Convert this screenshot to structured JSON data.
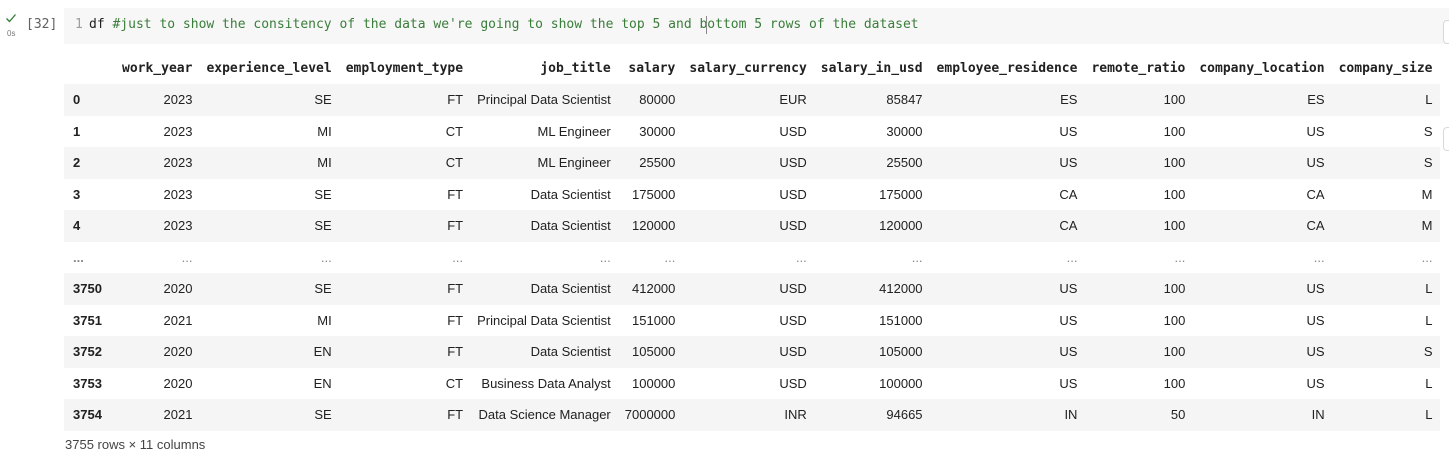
{
  "cell": {
    "execution_count": "[32]",
    "exec_time": "0s",
    "line_number": "1",
    "code_var": "df",
    "code_comment": "#just to show the consitency of the data we're going to show the top 5 and bottom 5 rows of the dataset"
  },
  "table": {
    "columns": [
      "work_year",
      "experience_level",
      "employment_type",
      "job_title",
      "salary",
      "salary_currency",
      "salary_in_usd",
      "employee_residence",
      "remote_ratio",
      "company_location",
      "company_size"
    ],
    "rows": [
      {
        "index": "0",
        "cells": [
          "2023",
          "SE",
          "FT",
          "Principal Data Scientist",
          "80000",
          "EUR",
          "85847",
          "ES",
          "100",
          "ES",
          "L"
        ]
      },
      {
        "index": "1",
        "cells": [
          "2023",
          "MI",
          "CT",
          "ML Engineer",
          "30000",
          "USD",
          "30000",
          "US",
          "100",
          "US",
          "S"
        ]
      },
      {
        "index": "2",
        "cells": [
          "2023",
          "MI",
          "CT",
          "ML Engineer",
          "25500",
          "USD",
          "25500",
          "US",
          "100",
          "US",
          "S"
        ]
      },
      {
        "index": "3",
        "cells": [
          "2023",
          "SE",
          "FT",
          "Data Scientist",
          "175000",
          "USD",
          "175000",
          "CA",
          "100",
          "CA",
          "M"
        ]
      },
      {
        "index": "4",
        "cells": [
          "2023",
          "SE",
          "FT",
          "Data Scientist",
          "120000",
          "USD",
          "120000",
          "CA",
          "100",
          "CA",
          "M"
        ]
      },
      {
        "index": "...",
        "cells": [
          "...",
          "...",
          "...",
          "...",
          "...",
          "...",
          "...",
          "...",
          "...",
          "...",
          "..."
        ]
      },
      {
        "index": "3750",
        "cells": [
          "2020",
          "SE",
          "FT",
          "Data Scientist",
          "412000",
          "USD",
          "412000",
          "US",
          "100",
          "US",
          "L"
        ]
      },
      {
        "index": "3751",
        "cells": [
          "2021",
          "MI",
          "FT",
          "Principal Data Scientist",
          "151000",
          "USD",
          "151000",
          "US",
          "100",
          "US",
          "L"
        ]
      },
      {
        "index": "3752",
        "cells": [
          "2020",
          "EN",
          "FT",
          "Data Scientist",
          "105000",
          "USD",
          "105000",
          "US",
          "100",
          "US",
          "S"
        ]
      },
      {
        "index": "3753",
        "cells": [
          "2020",
          "EN",
          "CT",
          "Business Data Analyst",
          "100000",
          "USD",
          "100000",
          "US",
          "100",
          "US",
          "L"
        ]
      },
      {
        "index": "3754",
        "cells": [
          "2021",
          "SE",
          "FT",
          "Data Science Manager",
          "7000000",
          "INR",
          "94665",
          "IN",
          "50",
          "IN",
          "L"
        ]
      }
    ],
    "shape_note": "3755 rows × 11 columns"
  },
  "icons": {
    "run_status": "check-icon"
  },
  "colors": {
    "check": "#2e7d32",
    "code_bg": "#f7f7f7",
    "comment": "#3a7d3a",
    "row_stripe": "#f5f5f5"
  }
}
